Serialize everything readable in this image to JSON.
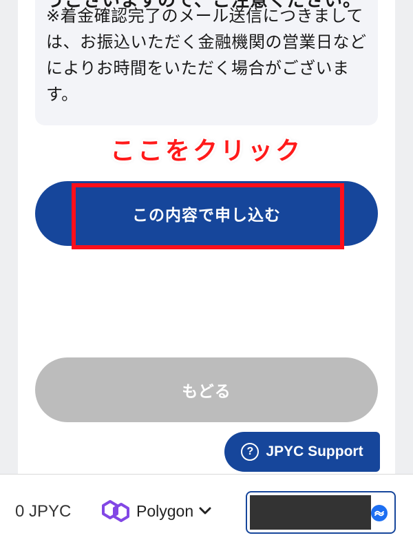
{
  "notice": {
    "cut_line": "うございますので、ご注意ください。",
    "text": "※着金確認完了のメール送信につきましては、お振込いただく金融機関の営業日などによりお時間をいただく場合がございます。"
  },
  "annotation": {
    "label": "ここをクリック",
    "color": "#ff1a1a"
  },
  "buttons": {
    "submit_label": "この内容で申し込む",
    "back_label": "もどる"
  },
  "support": {
    "label": "JPYC Support",
    "icon": "question-circle-icon"
  },
  "footer": {
    "balance": "0 JPYC",
    "network_name": "Polygon",
    "network_icon": "polygon-logo-icon",
    "wallet_icon": "wallet-connect-icon"
  },
  "colors": {
    "primary": "#16469b",
    "disabled": "#bcbcbc",
    "highlight": "#ff0f1a"
  }
}
